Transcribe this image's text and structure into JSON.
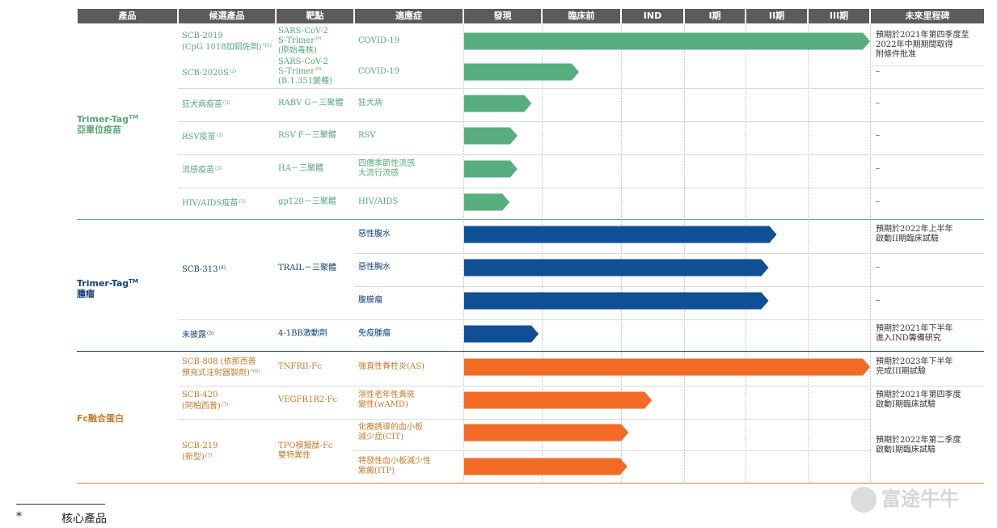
{
  "headers": [
    "產品",
    "候選產品",
    "靶點",
    "適應症",
    "發現",
    "臨床前",
    "IND",
    "I期",
    "II期",
    "III期",
    "未來里程碑"
  ],
  "colors": {
    "green": "#58ae7f",
    "blue": "#0f4f96",
    "orange": "#f26a24",
    "header_bg": "#5b5b5b"
  },
  "groups": [
    {
      "name": "Trimer-Tag",
      "sup": "TM",
      "sub": "亞單位疫苗",
      "color": "#57a878"
    },
    {
      "name": "Trimer-Tag",
      "sup": "TM",
      "sub": "腫瘤",
      "color": "#13407e"
    },
    {
      "name": "Fc融合蛋白",
      "sup": "",
      "sub": "",
      "color": "#c57b2b"
    }
  ],
  "rows": [
    {
      "candidate": "SCB-2019\n(CpG 1018加鋁佐劑)",
      "cand_sup": "*(1)",
      "target": "SARS-CoV-2\nS-Trimer™\n(原始毒株)",
      "indication": "COVID-19",
      "milestone": "預期於2021年第四季度至\n2022年中期期間取得\n附條件批准",
      "color": "green",
      "progress": 7.85
    },
    {
      "candidate": "SCB-2020S",
      "cand_sup": "(2)",
      "target": "SARS-CoV-2\nS-Trimer™\n(B.1.351變種)",
      "indication": "COVID-19",
      "milestone": "–",
      "color": "green",
      "progress": 1.47
    },
    {
      "candidate": "狂犬病疫苗",
      "cand_sup": "(3)",
      "target": "RABV G－三聚體",
      "indication": "狂犬病",
      "milestone": "–",
      "color": "green",
      "progress": 0.87
    },
    {
      "candidate": "RSV疫苗",
      "cand_sup": "(3)",
      "target": "RSV F－三聚體",
      "indication": "RSV",
      "milestone": "–",
      "color": "green",
      "progress": 0.69
    },
    {
      "candidate": "流感疫苗",
      "cand_sup": "(3)",
      "target": "HA－三聚體",
      "indication": "四價季節性流感\n大流行流感",
      "milestone": "–",
      "color": "green",
      "progress": 0.69
    },
    {
      "candidate": "HIV/AIDS疫苗",
      "cand_sup": "(3)",
      "target": "gp120－三聚體",
      "indication": "HIV/AIDS",
      "milestone": "–",
      "color": "green",
      "progress": 0.59
    },
    {
      "candidate": "SCB-313",
      "cand_sup": "(4)",
      "target": "TRAIL－三聚體",
      "indication": "惡性腹水",
      "milestone": "預期於2022年上半年\n啟動II期臨床試驗",
      "color": "blue",
      "progress": 4.5
    },
    {
      "candidate": "",
      "cand_sup": "",
      "target": "",
      "indication": "惡性胸水",
      "milestone": "–",
      "color": "blue",
      "progress": 4.37
    },
    {
      "candidate": "",
      "cand_sup": "",
      "target": "",
      "indication": "腹膜瘤",
      "milestone": "–",
      "color": "blue",
      "progress": 4.37
    },
    {
      "candidate": "未披露",
      "cand_sup": "(5)",
      "target": "4-1BB激動劑",
      "indication": "免疫腫瘤",
      "milestone": "預期於2021年下半年\n進入IND籌備研究",
      "color": "blue",
      "progress": 0.96
    },
    {
      "candidate": "SCB-808 (依那西普\n預充式注射器製劑)",
      "cand_sup": "*(6)",
      "target": "TNFRII-Fc",
      "indication": "強直性脊柱炎(AS)",
      "milestone": "預期於2023年下半年\n完成III期試驗",
      "color": "orange",
      "progress": 7.5
    },
    {
      "candidate": "SCB-420\n(阿柏西普)",
      "cand_sup": "(7)",
      "target": "VEGFR1R2-Fc",
      "indication": "濕性老年性黃斑\n變性(wAMD)",
      "milestone": "預期於2021年第四季度\n啟動I期臨床試驗",
      "color": "orange",
      "progress": 2.49
    },
    {
      "candidate": "SCB-219\n(新型)",
      "cand_sup": "(7)",
      "target": "TPO模擬肽-Fc\n雙特異性",
      "indication": "化療誘導的血小板\n減少症(CIT)",
      "milestone": "預期於2022年第二季度\n啟動I期臨床試驗",
      "color": "orange",
      "progress": 2.12
    },
    {
      "candidate": "",
      "cand_sup": "",
      "target": "",
      "indication": "特發性血小板減少性\n紫癜(ITP)",
      "milestone": "",
      "color": "orange",
      "progress": 2.1
    }
  ],
  "footnote": {
    "star": "*",
    "text": "核心產品"
  },
  "watermark": "富途牛牛"
}
